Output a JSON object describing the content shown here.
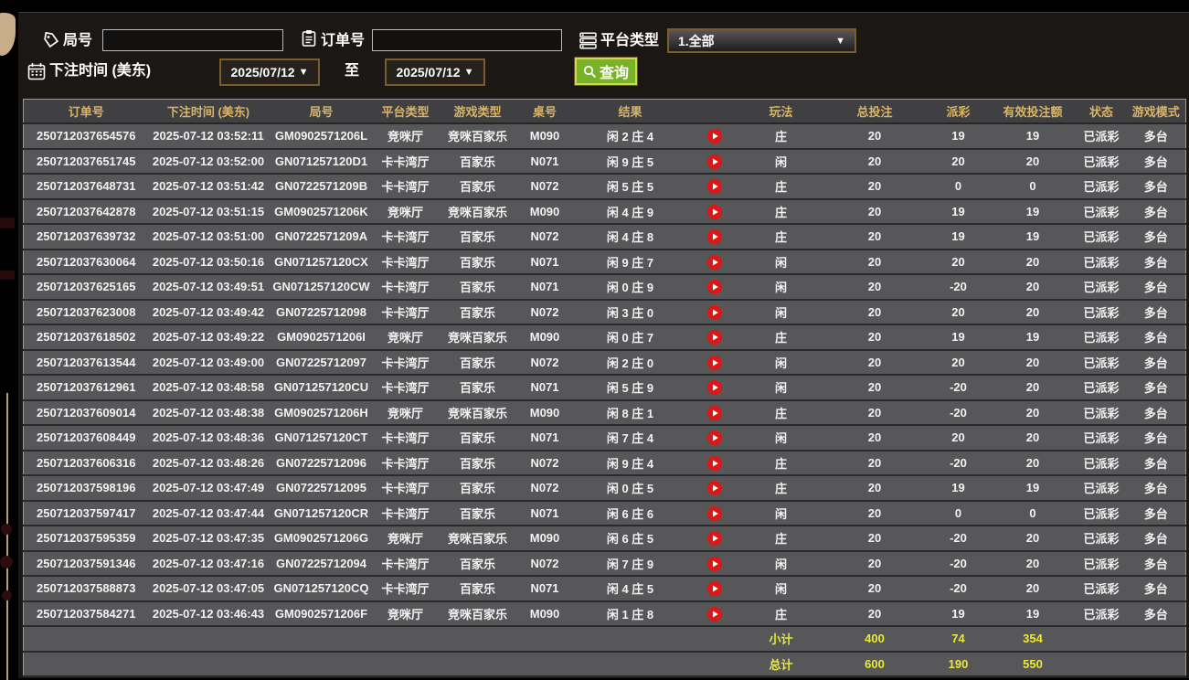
{
  "filters": {
    "game_no": {
      "label": "局号",
      "value": ""
    },
    "order_no": {
      "label": "订单号",
      "value": ""
    },
    "platform": {
      "label": "平台类型",
      "value": "1.全部",
      "arrow": "▼"
    },
    "bet_time": {
      "label": "下注时间 (美东)"
    },
    "date_from": {
      "value": "2025/07/12",
      "arrow": "▼"
    },
    "to_label": "至",
    "date_to": {
      "value": "2025/07/12",
      "arrow": "▼"
    },
    "query_button": {
      "label": "查询"
    }
  },
  "table": {
    "headers": [
      "订单号",
      "下注时间 (美东)",
      "局号",
      "平台类型",
      "游戏类型",
      "桌号",
      "结果",
      "",
      "玩法",
      "总投注",
      "派彩",
      "有效投注额",
      "状态",
      "游戏模式"
    ],
    "rows": [
      {
        "order_no": "250712037654576",
        "bet_time": "2025-07-12 03:52:11",
        "round_no": "GM0902571206L",
        "platform": "竞咪厅",
        "game_type": "竞咪百家乐",
        "table_no": "M090",
        "result": "闲 2 庄 4",
        "bet_side": "庄",
        "total_bet": "20",
        "payout": "19",
        "payout_state": "win",
        "valid_bet": "19",
        "status": "已派彩",
        "mode": "多台"
      },
      {
        "order_no": "250712037651745",
        "bet_time": "2025-07-12 03:52:00",
        "round_no": "GN071257120D1",
        "platform": "卡卡湾厅",
        "game_type": "百家乐",
        "table_no": "N071",
        "result": "闲 9 庄 5",
        "bet_side": "闲",
        "total_bet": "20",
        "payout": "20",
        "payout_state": "win",
        "valid_bet": "20",
        "status": "已派彩",
        "mode": "多台"
      },
      {
        "order_no": "250712037648731",
        "bet_time": "2025-07-12 03:51:42",
        "round_no": "GN0722571209B",
        "platform": "卡卡湾厅",
        "game_type": "百家乐",
        "table_no": "N072",
        "result": "闲 5 庄 5",
        "bet_side": "庄",
        "total_bet": "20",
        "payout": "0",
        "payout_state": "zero",
        "valid_bet": "0",
        "status": "已派彩",
        "mode": "多台"
      },
      {
        "order_no": "250712037642878",
        "bet_time": "2025-07-12 03:51:15",
        "round_no": "GM0902571206K",
        "platform": "竞咪厅",
        "game_type": "竞咪百家乐",
        "table_no": "M090",
        "result": "闲 4 庄 9",
        "bet_side": "庄",
        "total_bet": "20",
        "payout": "19",
        "payout_state": "win",
        "valid_bet": "19",
        "status": "已派彩",
        "mode": "多台"
      },
      {
        "order_no": "250712037639732",
        "bet_time": "2025-07-12 03:51:00",
        "round_no": "GN0722571209A",
        "platform": "卡卡湾厅",
        "game_type": "百家乐",
        "table_no": "N072",
        "result": "闲 4 庄 8",
        "bet_side": "庄",
        "total_bet": "20",
        "payout": "19",
        "payout_state": "win",
        "valid_bet": "19",
        "status": "已派彩",
        "mode": "多台"
      },
      {
        "order_no": "250712037630064",
        "bet_time": "2025-07-12 03:50:16",
        "round_no": "GN071257120CX",
        "platform": "卡卡湾厅",
        "game_type": "百家乐",
        "table_no": "N071",
        "result": "闲 9 庄 7",
        "bet_side": "闲",
        "total_bet": "20",
        "payout": "20",
        "payout_state": "win",
        "valid_bet": "20",
        "status": "已派彩",
        "mode": "多台"
      },
      {
        "order_no": "250712037625165",
        "bet_time": "2025-07-12 03:49:51",
        "round_no": "GN071257120CW",
        "platform": "卡卡湾厅",
        "game_type": "百家乐",
        "table_no": "N071",
        "result": "闲 0 庄 9",
        "bet_side": "闲",
        "total_bet": "20",
        "payout": "-20",
        "payout_state": "loss",
        "valid_bet": "20",
        "status": "已派彩",
        "mode": "多台"
      },
      {
        "order_no": "250712037623008",
        "bet_time": "2025-07-12 03:49:42",
        "round_no": "GN07225712098",
        "platform": "卡卡湾厅",
        "game_type": "百家乐",
        "table_no": "N072",
        "result": "闲 3 庄 0",
        "bet_side": "闲",
        "total_bet": "20",
        "payout": "20",
        "payout_state": "win",
        "valid_bet": "20",
        "status": "已派彩",
        "mode": "多台"
      },
      {
        "order_no": "250712037618502",
        "bet_time": "2025-07-12 03:49:22",
        "round_no": "GM0902571206I",
        "platform": "竞咪厅",
        "game_type": "竞咪百家乐",
        "table_no": "M090",
        "result": "闲 0 庄 7",
        "bet_side": "庄",
        "total_bet": "20",
        "payout": "19",
        "payout_state": "win",
        "valid_bet": "19",
        "status": "已派彩",
        "mode": "多台"
      },
      {
        "order_no": "250712037613544",
        "bet_time": "2025-07-12 03:49:00",
        "round_no": "GN07225712097",
        "platform": "卡卡湾厅",
        "game_type": "百家乐",
        "table_no": "N072",
        "result": "闲 2 庄 0",
        "bet_side": "闲",
        "total_bet": "20",
        "payout": "20",
        "payout_state": "win",
        "valid_bet": "20",
        "status": "已派彩",
        "mode": "多台"
      },
      {
        "order_no": "250712037612961",
        "bet_time": "2025-07-12 03:48:58",
        "round_no": "GN071257120CU",
        "platform": "卡卡湾厅",
        "game_type": "百家乐",
        "table_no": "N071",
        "result": "闲 5 庄 9",
        "bet_side": "闲",
        "total_bet": "20",
        "payout": "-20",
        "payout_state": "loss",
        "valid_bet": "20",
        "status": "已派彩",
        "mode": "多台"
      },
      {
        "order_no": "250712037609014",
        "bet_time": "2025-07-12 03:48:38",
        "round_no": "GM0902571206H",
        "platform": "竞咪厅",
        "game_type": "竞咪百家乐",
        "table_no": "M090",
        "result": "闲 8 庄 1",
        "bet_side": "庄",
        "total_bet": "20",
        "payout": "-20",
        "payout_state": "loss",
        "valid_bet": "20",
        "status": "已派彩",
        "mode": "多台"
      },
      {
        "order_no": "250712037608449",
        "bet_time": "2025-07-12 03:48:36",
        "round_no": "GN071257120CT",
        "platform": "卡卡湾厅",
        "game_type": "百家乐",
        "table_no": "N071",
        "result": "闲 7 庄 4",
        "bet_side": "闲",
        "total_bet": "20",
        "payout": "20",
        "payout_state": "win",
        "valid_bet": "20",
        "status": "已派彩",
        "mode": "多台"
      },
      {
        "order_no": "250712037606316",
        "bet_time": "2025-07-12 03:48:26",
        "round_no": "GN07225712096",
        "platform": "卡卡湾厅",
        "game_type": "百家乐",
        "table_no": "N072",
        "result": "闲 9 庄 4",
        "bet_side": "庄",
        "total_bet": "20",
        "payout": "-20",
        "payout_state": "loss",
        "valid_bet": "20",
        "status": "已派彩",
        "mode": "多台"
      },
      {
        "order_no": "250712037598196",
        "bet_time": "2025-07-12 03:47:49",
        "round_no": "GN07225712095",
        "platform": "卡卡湾厅",
        "game_type": "百家乐",
        "table_no": "N072",
        "result": "闲 0 庄 5",
        "bet_side": "庄",
        "total_bet": "20",
        "payout": "19",
        "payout_state": "win",
        "valid_bet": "19",
        "status": "已派彩",
        "mode": "多台"
      },
      {
        "order_no": "250712037597417",
        "bet_time": "2025-07-12 03:47:44",
        "round_no": "GN071257120CR",
        "platform": "卡卡湾厅",
        "game_type": "百家乐",
        "table_no": "N071",
        "result": "闲 6 庄 6",
        "bet_side": "闲",
        "total_bet": "20",
        "payout": "0",
        "payout_state": "zero",
        "valid_bet": "0",
        "status": "已派彩",
        "mode": "多台"
      },
      {
        "order_no": "250712037595359",
        "bet_time": "2025-07-12 03:47:35",
        "round_no": "GM0902571206G",
        "platform": "竞咪厅",
        "game_type": "竞咪百家乐",
        "table_no": "M090",
        "result": "闲 6 庄 5",
        "bet_side": "庄",
        "total_bet": "20",
        "payout": "-20",
        "payout_state": "loss",
        "valid_bet": "20",
        "status": "已派彩",
        "mode": "多台"
      },
      {
        "order_no": "250712037591346",
        "bet_time": "2025-07-12 03:47:16",
        "round_no": "GN07225712094",
        "platform": "卡卡湾厅",
        "game_type": "百家乐",
        "table_no": "N072",
        "result": "闲 7 庄 9",
        "bet_side": "闲",
        "total_bet": "20",
        "payout": "-20",
        "payout_state": "loss",
        "valid_bet": "20",
        "status": "已派彩",
        "mode": "多台"
      },
      {
        "order_no": "250712037588873",
        "bet_time": "2025-07-12 03:47:05",
        "round_no": "GN071257120CQ",
        "platform": "卡卡湾厅",
        "game_type": "百家乐",
        "table_no": "N071",
        "result": "闲 4 庄 5",
        "bet_side": "闲",
        "total_bet": "20",
        "payout": "-20",
        "payout_state": "loss",
        "valid_bet": "20",
        "status": "已派彩",
        "mode": "多台"
      },
      {
        "order_no": "250712037584271",
        "bet_time": "2025-07-12 03:46:43",
        "round_no": "GM0902571206F",
        "platform": "竞咪厅",
        "game_type": "竞咪百家乐",
        "table_no": "M090",
        "result": "闲 1 庄 8",
        "bet_side": "庄",
        "total_bet": "20",
        "payout": "19",
        "payout_state": "win",
        "valid_bet": "19",
        "status": "已派彩",
        "mode": "多台"
      }
    ],
    "summary": [
      {
        "label": "小计",
        "total_bet": "400",
        "payout": "74",
        "valid_bet": "354"
      },
      {
        "label": "总计",
        "total_bet": "600",
        "payout": "190",
        "valid_bet": "550"
      }
    ]
  },
  "icons": {
    "game_no": "tag-icon",
    "order_no": "clipboard-icon",
    "platform": "server-list-icon",
    "bet_time": "calendar-icon",
    "query": "search-icon",
    "row_action": "play-icon"
  },
  "colors": {
    "header_gold": "#d8b468",
    "payout_win_red": "#b71e37",
    "payout_loss_green": "#2fd32f",
    "status_green": "#2dd62d",
    "summary_yellow": "#e9e93b",
    "query_button_green": "#79b228",
    "play_icon_red": "#e01515",
    "row_gray": "#575659",
    "panel_dark": "#1a1715"
  }
}
